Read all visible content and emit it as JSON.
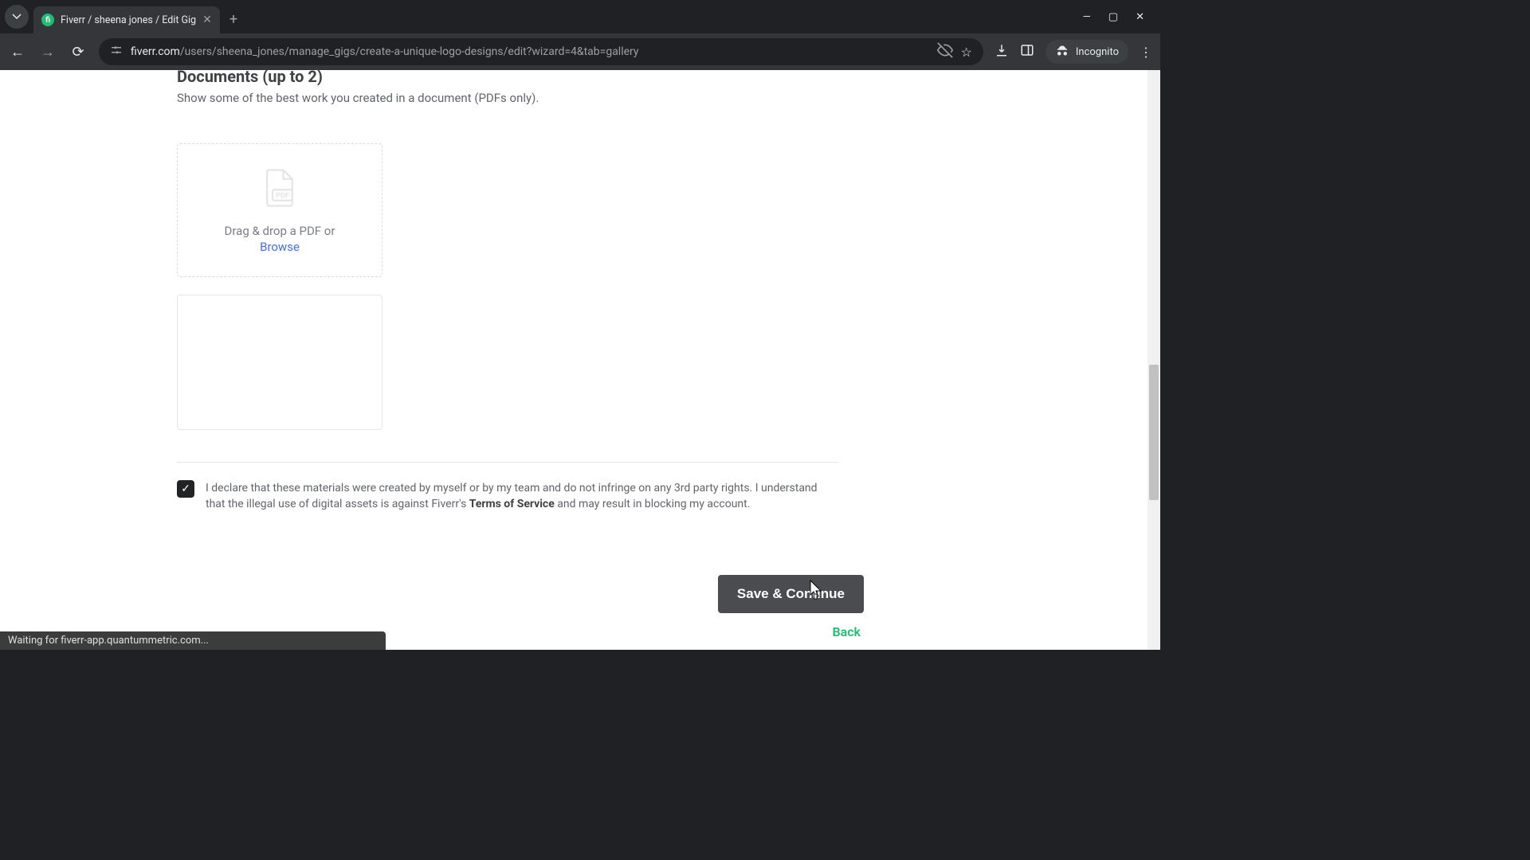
{
  "browser": {
    "tab_title": "Fiverr / sheena jones / Edit Gig",
    "url_domain": "fiverr.com",
    "url_path": "/users/sheena_jones/manage_gigs/create-a-unique-logo-designs/edit?wizard=4&tab=gallery",
    "incognito_label": "Incognito",
    "status_text": "Waiting for fiverr-app.quantummetric.com..."
  },
  "page": {
    "section_title": "Documents (up to 2)",
    "section_subtitle": "Show some of the best work you created in a document (PDFs only).",
    "drop_text": "Drag & drop a PDF or",
    "browse_label": "Browse",
    "declaration_pre": "I declare that these materials were created by myself or by my team and do not infringe on any 3rd party rights. I understand that the illegal use of digital assets is against Fiverr's ",
    "declaration_tos": "Terms of Service",
    "declaration_post": " and may result in blocking my account.",
    "save_label": "Save & Continue",
    "back_label": "Back"
  }
}
